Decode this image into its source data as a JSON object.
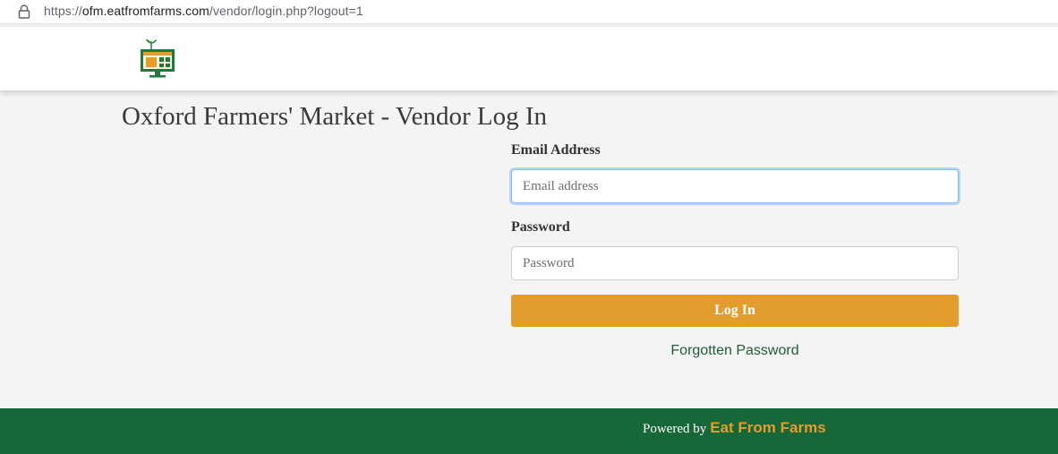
{
  "browser": {
    "url_scheme": "https://",
    "url_host": "ofm.eatfromfarms.com",
    "url_path": "/vendor/login.php?logout=1"
  },
  "page": {
    "title": "Oxford Farmers' Market - Vendor Log In"
  },
  "form": {
    "email_label": "Email Address",
    "email_placeholder": "Email address",
    "email_value": "",
    "password_label": "Password",
    "password_placeholder": "Password",
    "password_value": "",
    "login_label": "Log In",
    "forgot_label": "Forgotten Password"
  },
  "footer": {
    "powered_text": "Powered by",
    "brand_label": "Eat From Farms"
  },
  "colors": {
    "accent_orange": "#e39d2c",
    "footer_green": "#166839",
    "link_green": "#1f5e35",
    "page_background": "#f4f4f4"
  },
  "icons": {
    "address_bar": "lock-icon",
    "header_logo": "market-stall-logo-icon"
  }
}
